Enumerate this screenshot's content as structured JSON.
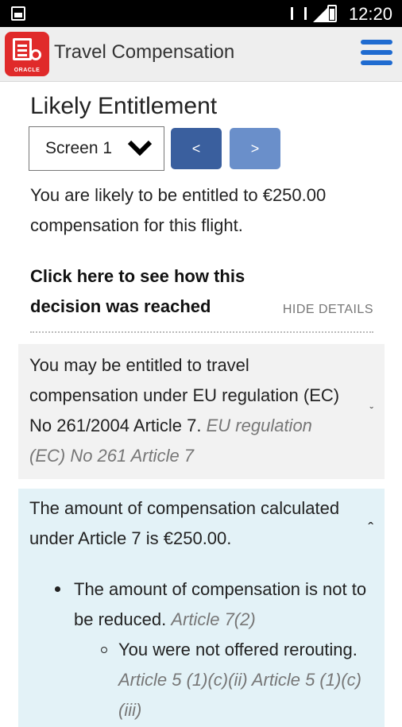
{
  "status": {
    "time": "12:20"
  },
  "app": {
    "title": "Travel Compensation",
    "logo_text": "ORACLE"
  },
  "page": {
    "title": "Likely Entitlement",
    "screen_select": "Screen 1",
    "prev_label": "<",
    "next_label": ">",
    "intro": "You are likely to be entitled to €250.00 compensation for this flight.",
    "decision_link": "Click here to see how this decision was reached",
    "hide_details": "HIDE DETAILS"
  },
  "reasons": [
    {
      "text": "You may be entitled to travel compensation under EU regulation (EC) No 261/2004 Article 7.",
      "citation": "EU regulation (EC) No 261 Article 7",
      "expanded": false
    },
    {
      "text": "The amount of compensation calculated under Article 7 is €250.00.",
      "expanded": true,
      "children": [
        {
          "text": "The amount of compensation is not to be reduced.",
          "citation": "Article 7(2)",
          "children": [
            {
              "text": "You were not offered rerouting.",
              "citation": "Article 5 (1)(c)(ii) Article 5 (1)(c)(iii)"
            }
          ]
        }
      ]
    }
  ],
  "colors": {
    "accent": "#1f6bd0",
    "prev_button": "#3a5f9e",
    "next_button": "#6a8fca",
    "card_grey": "#f2f2f2",
    "card_blue": "#e3f2f7",
    "logo_red": "#e02a2a"
  }
}
